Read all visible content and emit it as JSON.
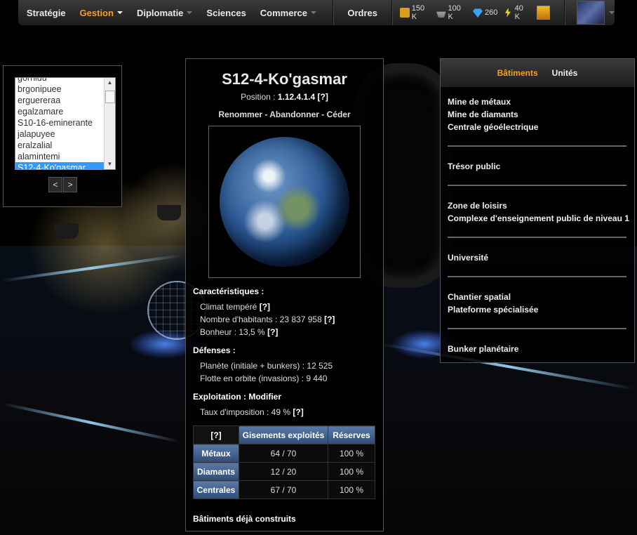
{
  "nav": {
    "items": [
      {
        "label": "Stratégie",
        "caret": false,
        "active": false
      },
      {
        "label": "Gestion",
        "caret": true,
        "active": true
      },
      {
        "label": "Diplomatie",
        "caret": true,
        "active": false
      },
      {
        "label": "Sciences",
        "caret": false,
        "active": false
      },
      {
        "label": "Commerce",
        "caret": true,
        "active": false
      }
    ],
    "orders_label": "Ordres",
    "resources": [
      {
        "icon": "metal-resource-icon",
        "value": "150 K"
      },
      {
        "icon": "ship-resource-icon",
        "value": "100 K"
      },
      {
        "icon": "diamond-resource-icon",
        "value": "260"
      },
      {
        "icon": "energy-resource-icon",
        "value": "40 K"
      }
    ],
    "accent": "#f5a020"
  },
  "planet_list": {
    "items": [
      "gornluu",
      "brgonipuee",
      "erguereraa",
      "egalzamare",
      "S10-16-eminerante",
      "jalapuyee",
      "eralzalial",
      "alamintemi",
      "S12-4-Ko'gasmar"
    ],
    "selected": "S12-4-Ko'gasmar",
    "prev_label": "<",
    "next_label": ">"
  },
  "planet": {
    "name": "S12-4-Ko'gasmar",
    "position_label": "Position :",
    "position_value": "1.12.4.1.4",
    "help": "[?]",
    "rename": "Renommer",
    "abandon": "Abandonner",
    "cede": "Céder",
    "dash": " - ",
    "characteristics_title": "Caractéristiques :",
    "climate": "Climat tempéré",
    "inhabitants": "Nombre d'habitants : 23 837 958",
    "happiness": "Bonheur : 13,5 %",
    "defenses_title": "Défenses :",
    "planet_defense": "Planète (initiale + bunkers) : 12 525",
    "orbit_fleet": "Flotte en orbite (invasions) : 9 440",
    "exploitation_title": "Exploitation :",
    "modify": "Modifier",
    "tax": "Taux d'imposition : 49 %",
    "built_title": "Bâtiments déjà construits"
  },
  "deposits": {
    "corner": "[?]",
    "col_exploited": "Gisements exploités",
    "col_reserves": "Réserves",
    "rows": [
      {
        "name": "Métaux",
        "exploited": "64 / 70",
        "reserves": "100 %"
      },
      {
        "name": "Diamants",
        "exploited": "12 / 20",
        "reserves": "100 %"
      },
      {
        "name": "Centrales",
        "exploited": "67 / 70",
        "reserves": "100 %"
      }
    ]
  },
  "buildings_panel": {
    "tab_buildings": "Bâtiments",
    "tab_units": "Unités",
    "groups": [
      [
        "Mine de métaux",
        "Mine de diamants",
        "Centrale géoélectrique"
      ],
      [
        "Trésor public"
      ],
      [
        "Zone de loisirs",
        "Complexe d'enseignement public de niveau 1"
      ],
      [
        "Université"
      ],
      [
        "Chantier spatial",
        "Plateforme spécialisée"
      ],
      [
        "Bunker planétaire"
      ]
    ]
  }
}
